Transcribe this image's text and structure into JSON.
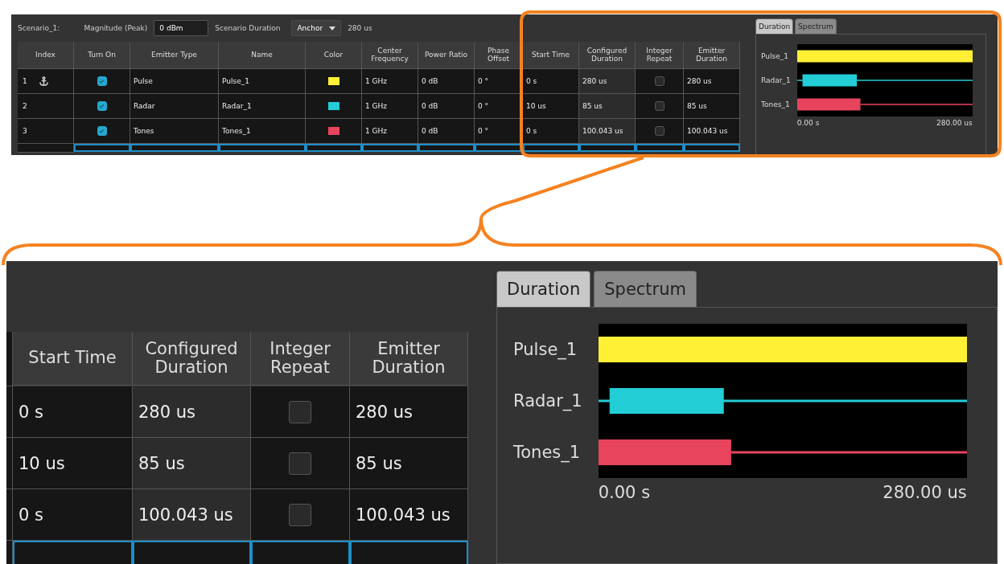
{
  "overview": {
    "scenario_label": "Scenario_1:",
    "magnitude": {
      "label": "Magnitude (Peak)",
      "value": "0 dBm"
    },
    "duration": {
      "label": "Scenario Duration",
      "value": "Anchor",
      "reading": "280 us"
    },
    "columns": [
      "Index",
      "Turn On",
      "Emitter Type",
      "Name",
      "Color",
      "Center Frequency",
      "Power Ratio",
      "Phase Offset",
      "Start Time",
      "Configured Duration",
      "Integer Repeat",
      "Emitter Duration"
    ],
    "rows": [
      {
        "index": "1",
        "anchor": true,
        "turn_on": true,
        "emitter_type": "Pulse",
        "name": "Pulse_1",
        "color": "#fff035",
        "center_frequency": "1 GHz",
        "power_ratio": "0 dB",
        "phase_offset": "0 °",
        "start_time": "0 s",
        "configured_duration": "280 us",
        "integer_repeat": false,
        "emitter_duration": "280 us"
      },
      {
        "index": "2",
        "anchor": false,
        "turn_on": true,
        "emitter_type": "Radar",
        "name": "Radar_1",
        "color": "#22cdd6",
        "center_frequency": "1 GHz",
        "power_ratio": "0 dB",
        "phase_offset": "0 °",
        "start_time": "10 us",
        "configured_duration": "85 us",
        "integer_repeat": false,
        "emitter_duration": "85 us"
      },
      {
        "index": "3",
        "anchor": false,
        "turn_on": true,
        "emitter_type": "Tones",
        "name": "Tones_1",
        "color": "#e8445e",
        "center_frequency": "1 GHz",
        "power_ratio": "0 dB",
        "phase_offset": "0 °",
        "start_time": "0 s",
        "configured_duration": "100.043 us",
        "integer_repeat": false,
        "emitter_duration": "100.043 us"
      }
    ],
    "tabs": [
      {
        "label": "Duration",
        "selected": true
      },
      {
        "label": "Spectrum",
        "selected": false
      }
    ],
    "timeline": {
      "lanes": [
        {
          "label": "Pulse_1",
          "color": "#fff035"
        },
        {
          "label": "Radar_1",
          "color": "#22cdd6"
        },
        {
          "label": "Tones_1",
          "color": "#e8445e"
        }
      ],
      "axis_start": "0.00 s",
      "axis_end": "280.00 us"
    }
  },
  "zoom": {
    "columns": [
      "Start Time",
      "Configured Duration",
      "Integer Repeat",
      "Emitter Duration"
    ],
    "rows": [
      {
        "start_time": "0 s",
        "configured_duration": "280 us",
        "integer_repeat": false,
        "emitter_duration": "280 us"
      },
      {
        "start_time": "10 us",
        "configured_duration": "85 us",
        "integer_repeat": false,
        "emitter_duration": "85 us"
      },
      {
        "start_time": "0 s",
        "configured_duration": "100.043 us",
        "integer_repeat": false,
        "emitter_duration": "100.043 us"
      }
    ],
    "tabs": [
      {
        "label": "Duration",
        "selected": true
      },
      {
        "label": "Spectrum",
        "selected": false
      }
    ],
    "timeline": {
      "lanes": [
        {
          "label": "Pulse_1",
          "color": "#fff035"
        },
        {
          "label": "Radar_1",
          "color": "#22cdd6"
        },
        {
          "label": "Tones_1",
          "color": "#e8445e"
        }
      ],
      "axis_start": "0.00 s",
      "axis_end": "280.00 us"
    }
  }
}
